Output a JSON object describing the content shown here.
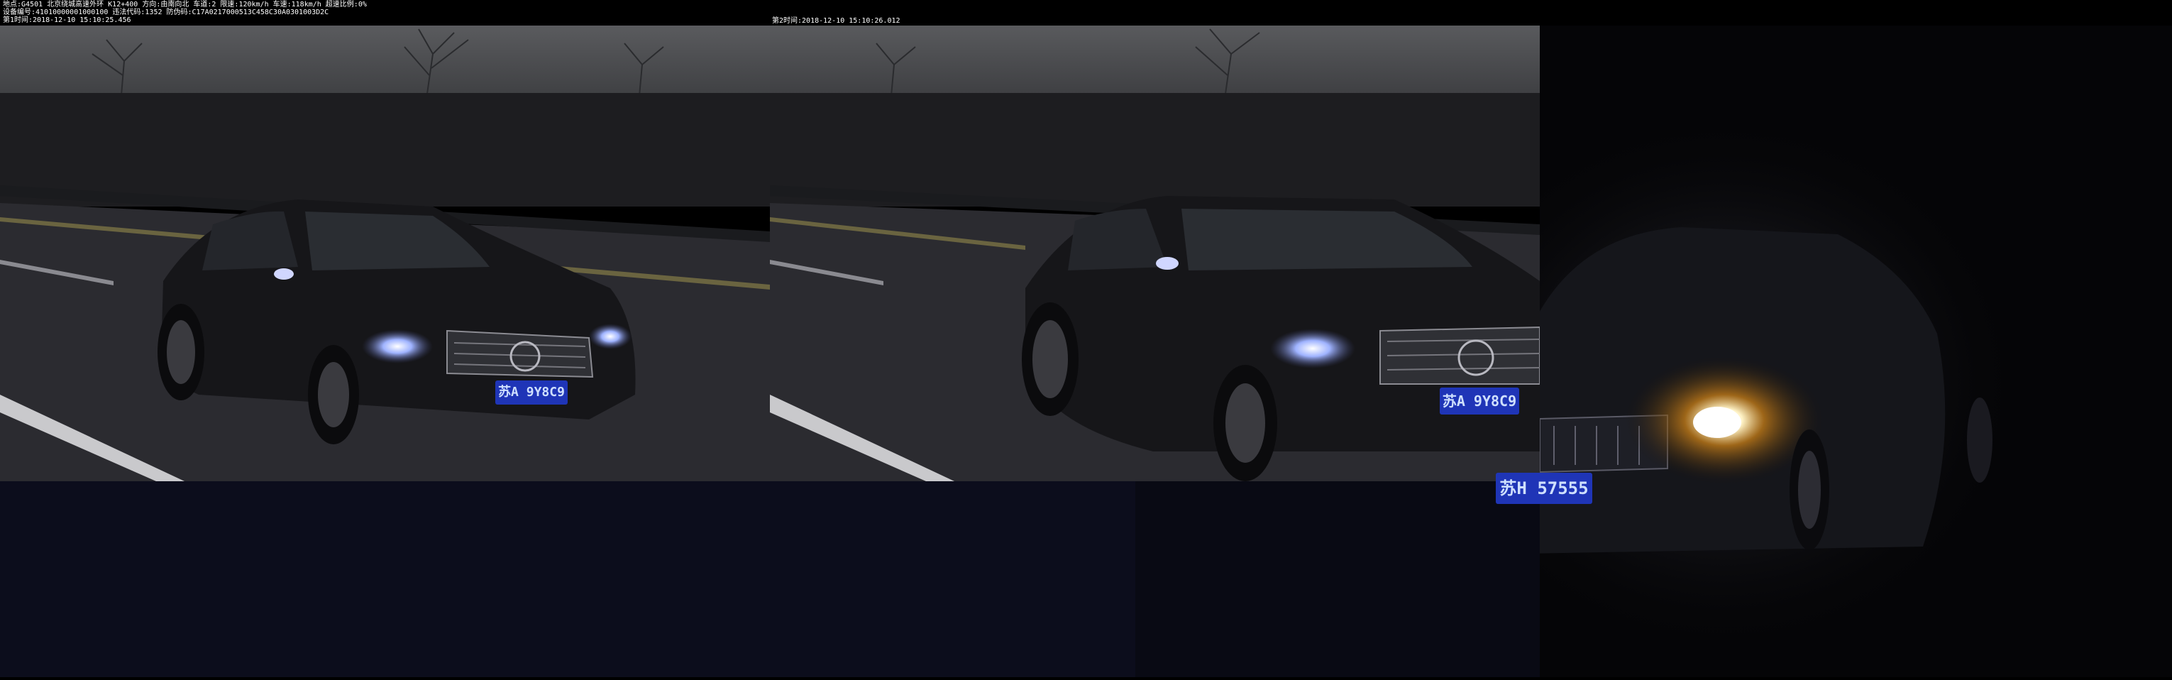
{
  "overlay": {
    "line1": "地点:G4501 北京绕城高速外环 K12+400 方向:由南向北 车道:2 限速:120km/h 车速:118km/h 超速比例:0%",
    "line2": "设备编号:41010000001000100 违法代码:1352 防伪码:C17A0217000513C458C30A0301003D2C",
    "line3": "第1时间:2018-12-10 15:10:25.456",
    "second_time": "第2时间:2018-12-10 15:10:26.012"
  },
  "plates": {
    "car_main": "苏A 9Y8C9",
    "car_closeup": "苏A 9Y8C9",
    "car_right": "苏H 57555"
  },
  "colors": {
    "plate_blue": "#1f35b7",
    "sky": "#4a4c50",
    "road": "#2b2b30"
  }
}
